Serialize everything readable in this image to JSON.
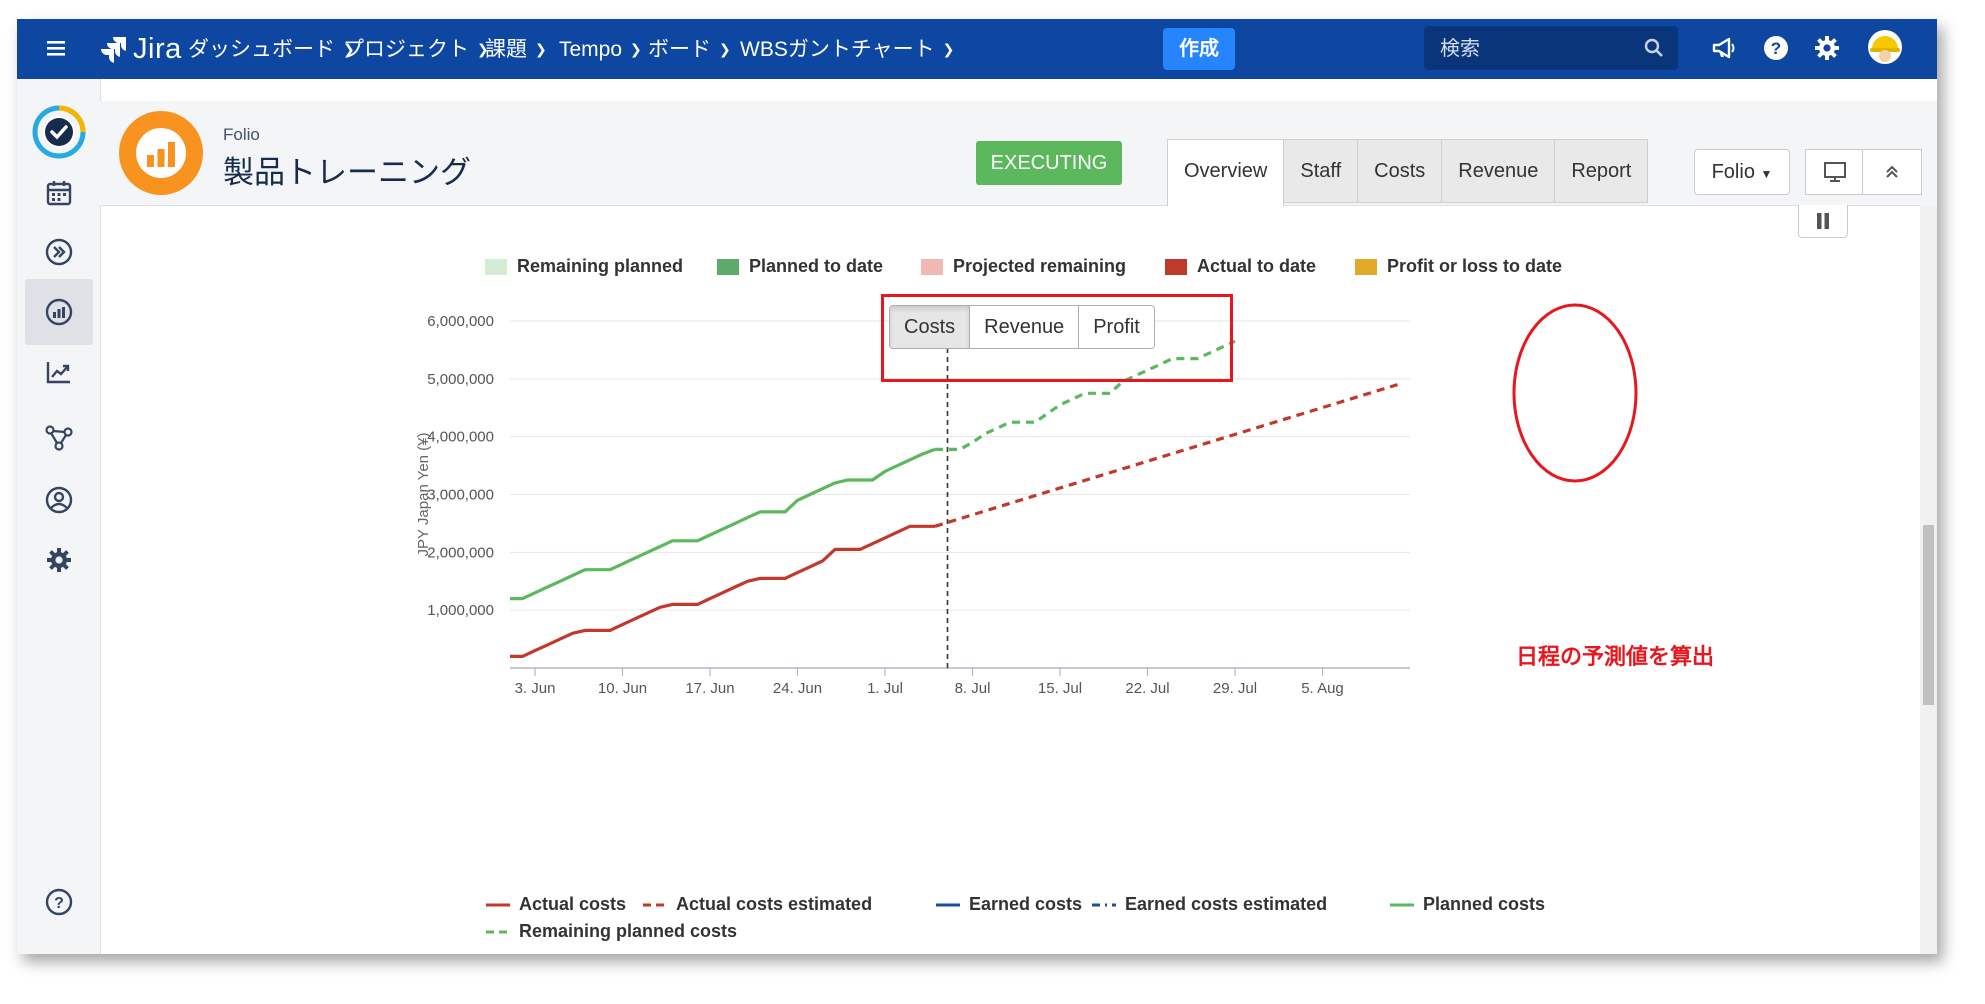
{
  "topbar": {
    "brand": "Jira",
    "nav": [
      {
        "label": "ダッシュボード"
      },
      {
        "label": "プロジェクト"
      },
      {
        "label": "課題"
      },
      {
        "label": "Tempo"
      },
      {
        "label": "ボード"
      },
      {
        "label": "WBSガントチャート"
      }
    ],
    "create_label": "作成",
    "search_placeholder": "検索"
  },
  "project": {
    "small_label": "Folio",
    "title": "製品トレーニング",
    "status": "EXECUTING",
    "tabs": [
      "Overview",
      "Staff",
      "Costs",
      "Revenue",
      "Report"
    ],
    "active_tab": "Overview",
    "folio_dropdown": "Folio"
  },
  "colors": {
    "topbar": "#0e47a1",
    "create": "#2684ff",
    "status": "#5cb85c",
    "planned": "#5cb85c",
    "actual": "#c0392b",
    "annotation": "#e8171f"
  },
  "legend_top": [
    {
      "label": "Remaining planned",
      "color": "#d4ecd6"
    },
    {
      "label": "Planned to date",
      "color": "#5cab6c"
    },
    {
      "label": "Projected remaining",
      "color": "#efb8b2"
    },
    {
      "label": "Actual to date",
      "color": "#c0392b"
    },
    {
      "label": "Profit or loss to date",
      "color": "#e0a92a"
    }
  ],
  "toggle": {
    "options": [
      "Costs",
      "Revenue",
      "Profit"
    ],
    "active": "Costs"
  },
  "annotation": "日程の予測値を算出",
  "chart_data": {
    "type": "line",
    "ylabel": "JPY Japan Yen (¥)",
    "y_ticks": [
      "6,000,000",
      "5,000,000",
      "4,000,000",
      "3,000,000",
      "2,000,000",
      "1,000,000"
    ],
    "ylim": [
      0,
      6000000
    ],
    "x_ticks": [
      "3. Jun",
      "10. Jun",
      "17. Jun",
      "24. Jun",
      "1. Jul",
      "8. Jul",
      "15. Jul",
      "22. Jul",
      "29. Jul",
      "5. Aug"
    ],
    "x_tick_days": [
      3,
      10,
      17,
      24,
      31,
      38,
      45,
      52,
      59,
      66
    ],
    "x_unit_note": "day of June (Jul 1 = 31)",
    "xlim": [
      1,
      73
    ],
    "today_day": 36,
    "grid": true,
    "series": [
      {
        "name": "Actual costs",
        "color": "#c0392b",
        "dash": "solid",
        "points": [
          [
            1,
            200000
          ],
          [
            2,
            200000
          ],
          [
            3,
            300000
          ],
          [
            4,
            400000
          ],
          [
            5,
            500000
          ],
          [
            6,
            600000
          ],
          [
            7,
            650000
          ],
          [
            8,
            650000
          ],
          [
            9,
            650000
          ],
          [
            10,
            750000
          ],
          [
            11,
            850000
          ],
          [
            12,
            950000
          ],
          [
            13,
            1050000
          ],
          [
            14,
            1100000
          ],
          [
            15,
            1100000
          ],
          [
            16,
            1100000
          ],
          [
            17,
            1200000
          ],
          [
            18,
            1300000
          ],
          [
            19,
            1400000
          ],
          [
            20,
            1500000
          ],
          [
            21,
            1550000
          ],
          [
            22,
            1550000
          ],
          [
            23,
            1550000
          ],
          [
            24,
            1650000
          ],
          [
            25,
            1750000
          ],
          [
            26,
            1850000
          ],
          [
            27,
            2050000
          ],
          [
            28,
            2050000
          ],
          [
            29,
            2050000
          ],
          [
            30,
            2150000
          ],
          [
            31,
            2250000
          ],
          [
            32,
            2350000
          ],
          [
            33,
            2450000
          ],
          [
            34,
            2450000
          ],
          [
            35,
            2450000
          ]
        ]
      },
      {
        "name": "Actual costs estimated",
        "color": "#c0392b",
        "dash": "dashed",
        "points": [
          [
            35,
            2450000
          ],
          [
            72,
            4900000
          ]
        ]
      },
      {
        "name": "Earned costs",
        "color": "#1f4e99",
        "dash": "solid",
        "points": []
      },
      {
        "name": "Earned costs estimated",
        "color": "#1f4e99",
        "dash": "dashdot",
        "points": []
      },
      {
        "name": "Planned costs",
        "color": "#5cb85c",
        "dash": "solid",
        "points": [
          [
            1,
            1200000
          ],
          [
            2,
            1200000
          ],
          [
            3,
            1300000
          ],
          [
            4,
            1400000
          ],
          [
            5,
            1500000
          ],
          [
            6,
            1600000
          ],
          [
            7,
            1700000
          ],
          [
            8,
            1700000
          ],
          [
            9,
            1700000
          ],
          [
            10,
            1800000
          ],
          [
            11,
            1900000
          ],
          [
            12,
            2000000
          ],
          [
            13,
            2100000
          ],
          [
            14,
            2200000
          ],
          [
            15,
            2200000
          ],
          [
            16,
            2200000
          ],
          [
            17,
            2300000
          ],
          [
            18,
            2400000
          ],
          [
            19,
            2500000
          ],
          [
            20,
            2600000
          ],
          [
            21,
            2700000
          ],
          [
            22,
            2700000
          ],
          [
            23,
            2700000
          ],
          [
            24,
            2900000
          ],
          [
            25,
            3000000
          ],
          [
            26,
            3100000
          ],
          [
            27,
            3200000
          ],
          [
            28,
            3250000
          ],
          [
            29,
            3250000
          ],
          [
            30,
            3250000
          ],
          [
            31,
            3400000
          ],
          [
            32,
            3500000
          ],
          [
            33,
            3600000
          ],
          [
            34,
            3700000
          ],
          [
            35,
            3780000
          ]
        ]
      },
      {
        "name": "Remaining planned costs",
        "color": "#5cb85c",
        "dash": "dashed",
        "points": [
          [
            35,
            3780000
          ],
          [
            36,
            3780000
          ],
          [
            37,
            3780000
          ],
          [
            38,
            3900000
          ],
          [
            39,
            4050000
          ],
          [
            40,
            4150000
          ],
          [
            41,
            4250000
          ],
          [
            42,
            4250000
          ],
          [
            43,
            4250000
          ],
          [
            44,
            4400000
          ],
          [
            45,
            4550000
          ],
          [
            46,
            4650000
          ],
          [
            47,
            4750000
          ],
          [
            48,
            4750000
          ],
          [
            49,
            4750000
          ],
          [
            50,
            4950000
          ],
          [
            51,
            5050000
          ],
          [
            52,
            5150000
          ],
          [
            53,
            5250000
          ],
          [
            54,
            5350000
          ],
          [
            55,
            5350000
          ],
          [
            56,
            5350000
          ],
          [
            57,
            5450000
          ],
          [
            58,
            5550000
          ],
          [
            59,
            5650000
          ]
        ]
      }
    ]
  },
  "sidebar": {
    "items": [
      "app-logo",
      "calendar",
      "forward",
      "dashboard",
      "trending",
      "graph",
      "account",
      "settings",
      "help"
    ]
  }
}
